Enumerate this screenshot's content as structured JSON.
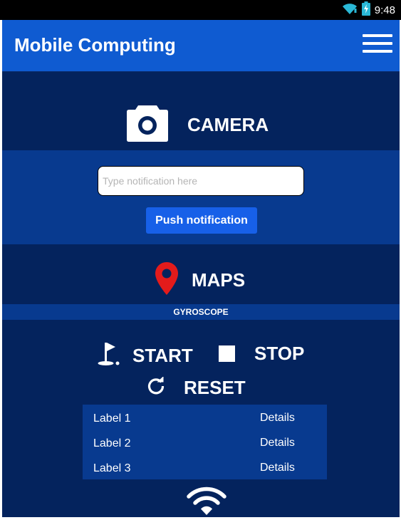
{
  "status_bar": {
    "time": "9:48"
  },
  "app_bar": {
    "title": "Mobile Computing"
  },
  "camera": {
    "label": "CAMERA"
  },
  "notification": {
    "placeholder": "Type notification here",
    "button_label": "Push notification"
  },
  "maps": {
    "label": "MAPS"
  },
  "gyroscope": {
    "label": "GYROSCOPE"
  },
  "controls": {
    "start": "START",
    "stop": "STOP",
    "reset": "RESET"
  },
  "labels": [
    {
      "name": "Label 1",
      "detail": "Details"
    },
    {
      "name": "Label 2",
      "detail": "Details"
    },
    {
      "name": "Label 3",
      "detail": "Details"
    }
  ],
  "colors": {
    "app_bar": "#0f5bd1",
    "background": "#04235d",
    "panel": "#083a8f",
    "button": "#1760e8",
    "map_pin": "#e31b1b",
    "status_accent": "#2ab8d6"
  },
  "icons": [
    "wifi-icon",
    "battery-icon",
    "menu-icon",
    "camera-icon",
    "map-pin-icon",
    "golf-flag-icon",
    "stop-icon",
    "refresh-icon",
    "wifi-icon"
  ]
}
